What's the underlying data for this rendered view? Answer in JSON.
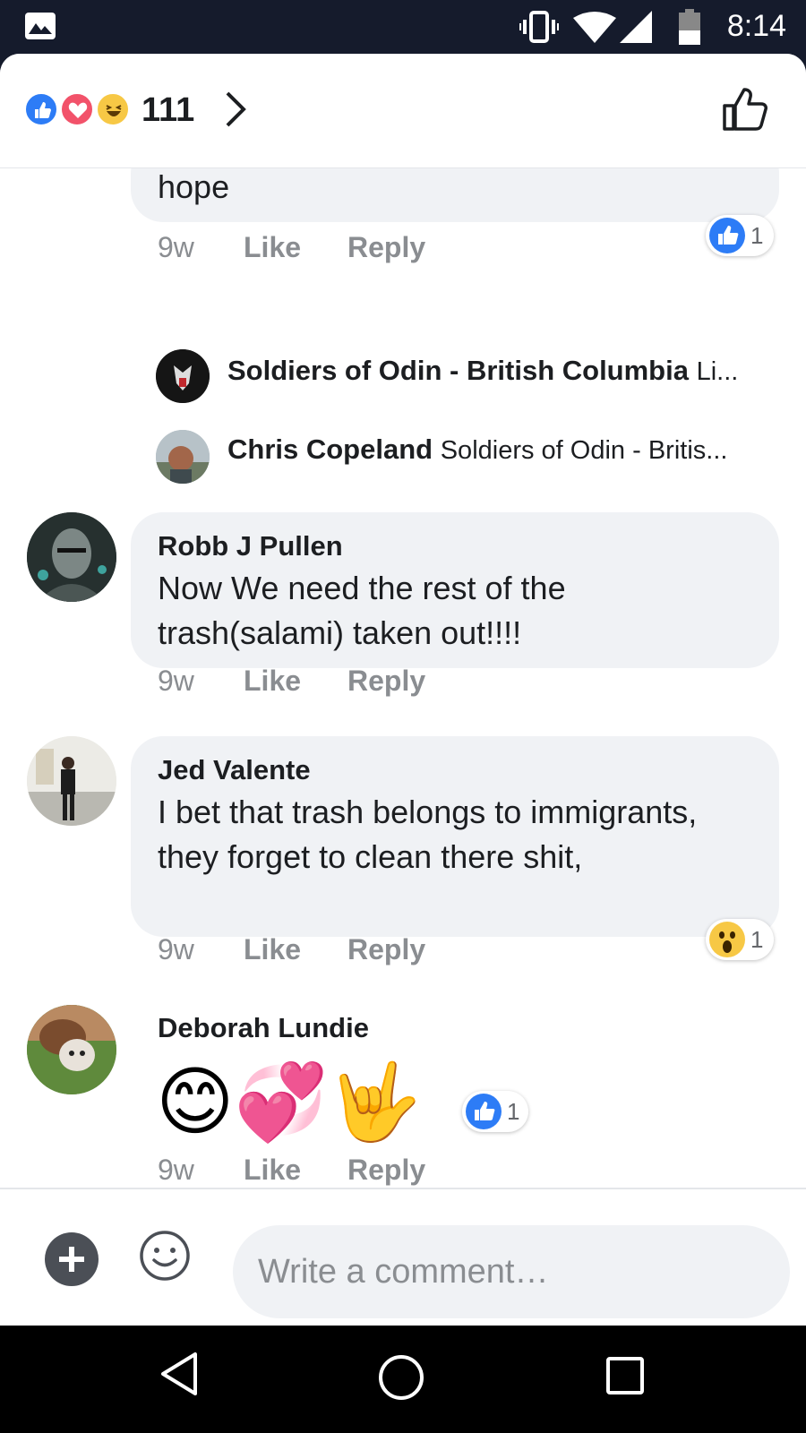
{
  "status_bar": {
    "time": "8:14",
    "icons": [
      "gallery-icon",
      "vibrate-icon",
      "wifi-icon",
      "signal-icon",
      "battery-icon"
    ]
  },
  "reactions": {
    "types": [
      "like",
      "love",
      "haha"
    ],
    "count": "111"
  },
  "colors": {
    "like_blue": "#2d7cf6",
    "love_red": "#f2526a",
    "haha_yellow": "#f7c845",
    "bubble_gray": "#f0f2f5",
    "meta_gray": "#8a8d91"
  },
  "comments": [
    {
      "body": "hope",
      "time": "9w",
      "like_label": "Like",
      "reply_label": "Reply",
      "reaction": {
        "type": "like",
        "count": "1"
      }
    },
    {
      "author": "Robb J Pullen",
      "body": "Now We need the rest of the trash(salami) taken out!!!!",
      "time": "9w",
      "like_label": "Like",
      "reply_label": "Reply"
    },
    {
      "author": "Jed Valente",
      "body": "I bet that trash belongs to immigrants, they forget to clean there shit,",
      "time": "9w",
      "like_label": "Like",
      "reply_label": "Reply",
      "reaction": {
        "type": "wow",
        "count": "1"
      }
    },
    {
      "author": "Deborah Lundie",
      "emojis": [
        "😊",
        "💞",
        "🤟"
      ],
      "time": "9w",
      "like_label": "Like",
      "reply_label": "Reply",
      "reaction": {
        "type": "like",
        "count": "1"
      }
    }
  ],
  "replies": [
    {
      "author": "Soldiers of Odin - British Columbia",
      "snippet": "Li..."
    },
    {
      "author": "Chris Copeland",
      "snippet": "Soldiers of Odin - Britis..."
    }
  ],
  "composer": {
    "placeholder": "Write a comment…"
  }
}
